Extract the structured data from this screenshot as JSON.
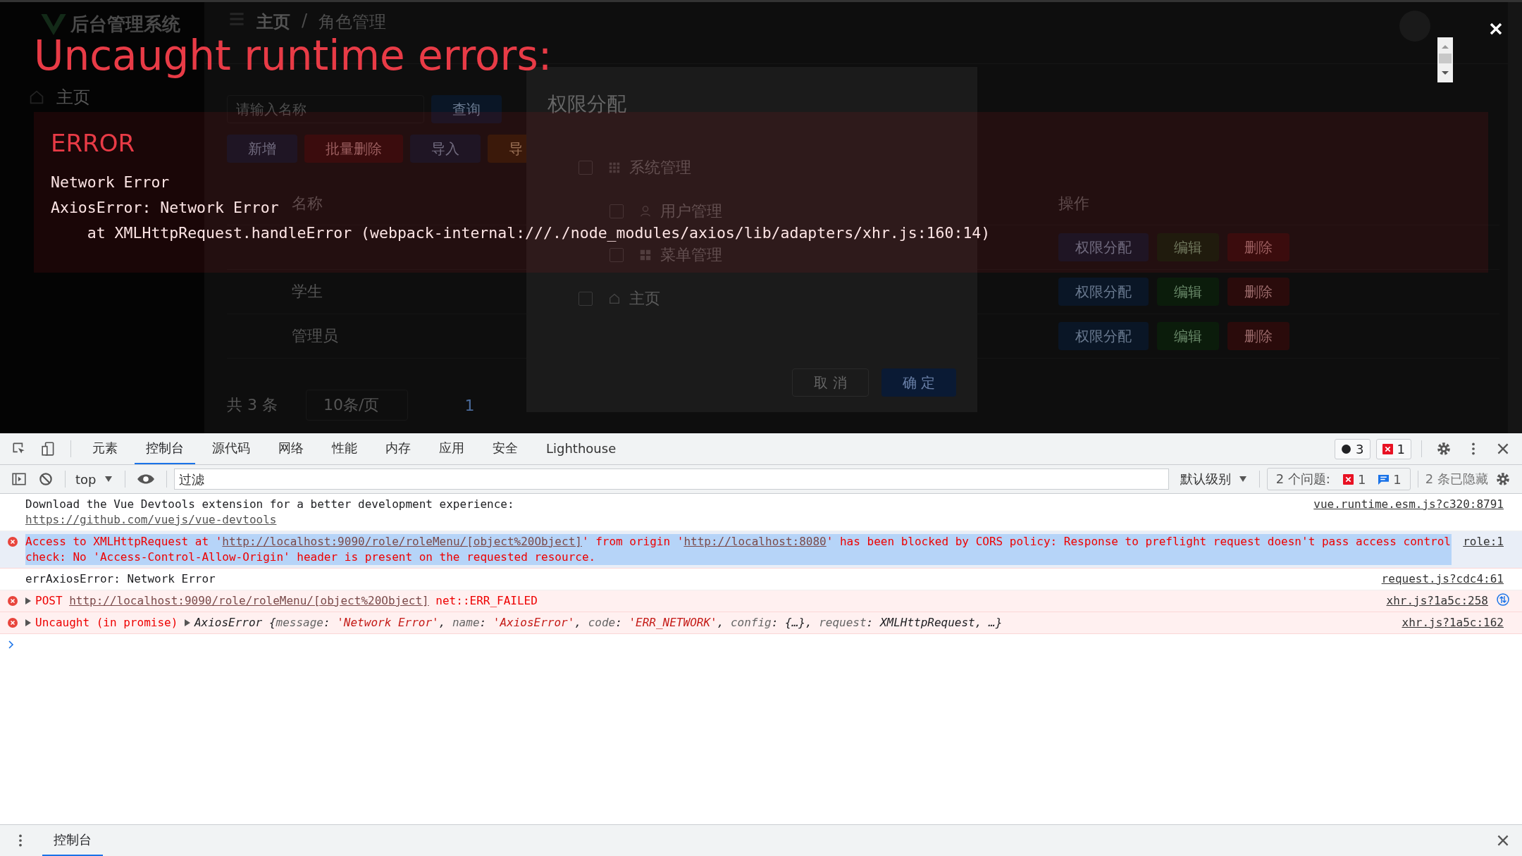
{
  "page_behind": {
    "brand": "后台管理系统",
    "breadcrumb": [
      "主页",
      "角色管理"
    ],
    "breadcrumb_separator": "/",
    "sidebar": [
      {
        "label": "主页",
        "kind": "home"
      }
    ],
    "search": {
      "placeholder": "请输入名称"
    },
    "search_button": "查询",
    "toolbar_buttons": [
      {
        "label": "新增",
        "kind": "primary"
      },
      {
        "label": "批量删除",
        "kind": "danger"
      },
      {
        "label": "导入",
        "kind": "primary"
      },
      {
        "label": "导",
        "kind": "warning"
      }
    ],
    "table": {
      "columns": [
        "名称",
        "操作"
      ],
      "rows": [
        {
          "name": "学生",
          "actions": [
            "权限分配",
            "编辑",
            "删除"
          ]
        },
        {
          "name": "管理员",
          "actions": [
            "权限分配",
            "编辑",
            "删除"
          ]
        }
      ],
      "first_row_actions": [
        "权限分配",
        "编辑",
        "删除"
      ]
    },
    "pagination": {
      "total": "共 3 条",
      "page_size": "10条/页",
      "page": "1"
    },
    "dialog": {
      "title": "权限分配",
      "tree": [
        {
          "label": "系统管理",
          "kind": "grid",
          "checked": false,
          "children": [
            {
              "label": "用户管理",
              "kind": "user",
              "checked": false
            },
            {
              "label": "菜单管理",
              "kind": "grid",
              "checked": false
            }
          ]
        },
        {
          "label": "主页",
          "kind": "home",
          "checked": false
        }
      ],
      "buttons": [
        "取 消",
        "确 定"
      ]
    }
  },
  "overlay": {
    "title": "Uncaught runtime errors:",
    "error_label": "ERROR",
    "lines": [
      "Network Error",
      "AxiosError: Network Error",
      "    at XMLHttpRequest.handleError (webpack-internal:///./node_modules/axios/lib/adapters/xhr.js:160:14)"
    ]
  },
  "devtools": {
    "tabs": [
      {
        "label": "元素",
        "selected": false
      },
      {
        "label": "控制台",
        "selected": true
      },
      {
        "label": "源代码",
        "selected": false
      },
      {
        "label": "网络",
        "selected": false
      },
      {
        "label": "性能",
        "selected": false
      },
      {
        "label": "内存",
        "selected": false
      },
      {
        "label": "应用",
        "selected": false
      },
      {
        "label": "安全",
        "selected": false
      },
      {
        "label": "Lighthouse",
        "selected": false
      }
    ],
    "counters": [
      {
        "kind": "dot",
        "count": "3"
      },
      {
        "kind": "error",
        "count": "1"
      }
    ],
    "context": "top",
    "filter": {
      "placeholder": "过滤"
    },
    "level": "默认级别",
    "issues": {
      "label": "2 个问题:",
      "errors": "1",
      "infos": "1"
    },
    "hidden": "2 条已隐藏",
    "messages": [
      {
        "kind": "log",
        "expandable": false,
        "selected": false,
        "network_icon": false,
        "segments": [
          {
            "kind": "text",
            "text": "Download the Vue Devtools extension for a better development experience:"
          },
          {
            "kind": "link_block",
            "text": "https://github.com/vuejs/vue-devtools"
          }
        ],
        "source": "vue.runtime.esm.js?c320:8791"
      },
      {
        "kind": "error",
        "expandable": false,
        "selected": true,
        "network_icon": false,
        "segments": [
          {
            "kind": "text",
            "text": "Access to XMLHttpRequest at '"
          },
          {
            "kind": "link",
            "text": "http://localhost:9090/role/roleMenu/[object%20Object]"
          },
          {
            "kind": "text",
            "text": "' from origin '"
          },
          {
            "kind": "link",
            "text": "http://localhost:8080"
          },
          {
            "kind": "text",
            "text": "' has been blocked by CORS policy: Response to preflight request doesn't pass access control check: No 'Access-Control-Allow-Origin' header is present on the requested resource."
          }
        ],
        "source": "role:1"
      },
      {
        "kind": "log",
        "expandable": false,
        "selected": false,
        "network_icon": false,
        "segments": [
          {
            "kind": "text",
            "text": "errAxiosError: Network Error"
          }
        ],
        "source": "request.js?cdc4:61"
      },
      {
        "kind": "error",
        "expandable": true,
        "selected": false,
        "network_icon": true,
        "segments": [
          {
            "kind": "text",
            "text": "POST "
          },
          {
            "kind": "link",
            "text": "http://localhost:9090/role/roleMenu/[object%20Object]"
          },
          {
            "kind": "text",
            "text": " net::ERR_FAILED"
          }
        ],
        "source": "xhr.js?1a5c:258"
      },
      {
        "kind": "error",
        "expandable": true,
        "selected": false,
        "network_icon": false,
        "segments": [
          {
            "kind": "text",
            "text": "Uncaught (in promise) "
          },
          {
            "kind": "objtoggle",
            "text": "AxiosError"
          },
          {
            "kind": "obj",
            "text": " {"
          },
          {
            "kind": "key",
            "text": "message"
          },
          {
            "kind": "obj",
            "text": ": "
          },
          {
            "kind": "str",
            "text": "'Network Error'"
          },
          {
            "kind": "obj",
            "text": ", "
          },
          {
            "kind": "key",
            "text": "name"
          },
          {
            "kind": "obj",
            "text": ": "
          },
          {
            "kind": "str",
            "text": "'AxiosError'"
          },
          {
            "kind": "obj",
            "text": ", "
          },
          {
            "kind": "key",
            "text": "code"
          },
          {
            "kind": "obj",
            "text": ": "
          },
          {
            "kind": "str",
            "text": "'ERR_NETWORK'"
          },
          {
            "kind": "obj",
            "text": ", "
          },
          {
            "kind": "key",
            "text": "config"
          },
          {
            "kind": "obj",
            "text": ": {…}, "
          },
          {
            "kind": "key",
            "text": "request"
          },
          {
            "kind": "obj",
            "text": ": XMLHttpRequest, …}"
          }
        ],
        "source": "xhr.js?1a5c:162"
      }
    ],
    "drawer_tab": {
      "label": "控制台",
      "selected": true
    }
  }
}
